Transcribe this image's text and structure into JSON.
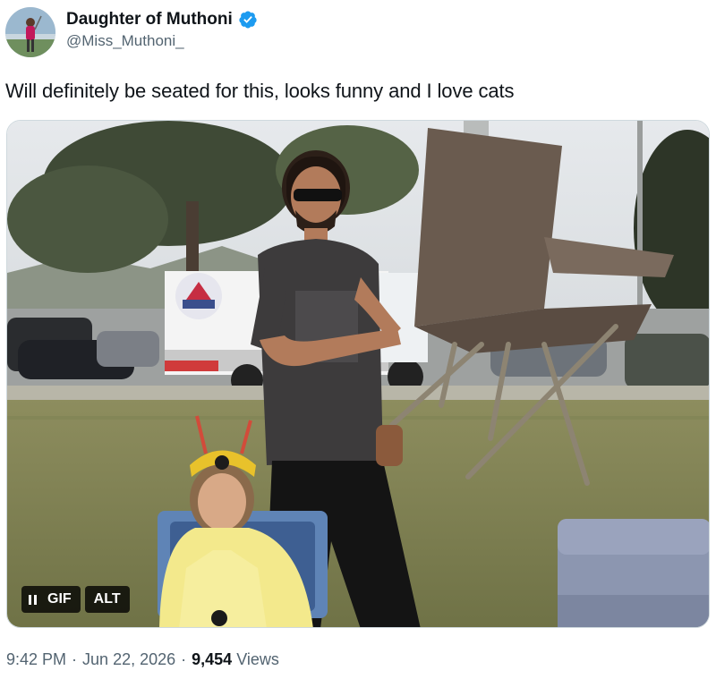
{
  "author": {
    "display_name": "Daughter of Muthoni",
    "handle": "@Miss_Muthoni_",
    "verified": true,
    "verified_color": "#1d9bf0"
  },
  "tweet": {
    "text": "Will definitely be seated for this, looks funny and I love cats"
  },
  "media": {
    "type": "GIF",
    "gif_label": "GIF",
    "alt_label": "ALT",
    "pause_icon": "pause-icon"
  },
  "meta": {
    "time": "9:42 PM",
    "separator": "·",
    "date": "Jun 22, 2026",
    "views_count": "9,454",
    "views_label": "Views"
  },
  "colors": {
    "text_primary": "#0f1419",
    "text_secondary": "#536471",
    "border": "#cfd9de"
  }
}
